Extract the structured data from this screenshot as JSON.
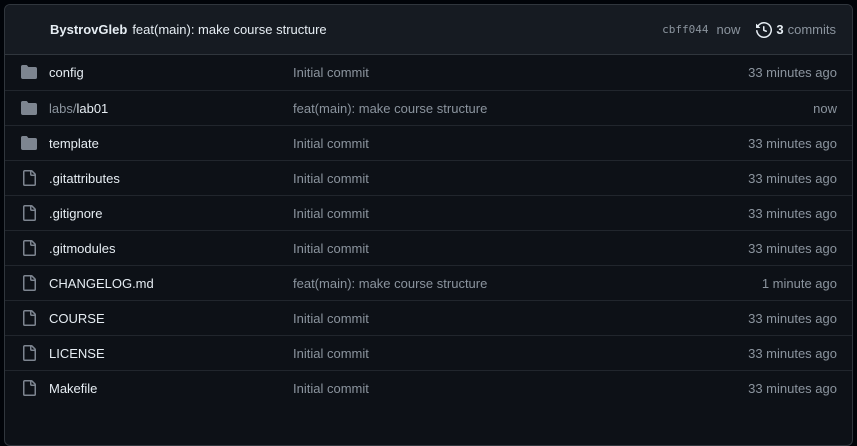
{
  "latest_commit": {
    "author": "BystrovGleb",
    "message": "feat(main): make course structure",
    "sha": "cbff044",
    "when": "now",
    "commit_count": "3",
    "commits_label": "commits"
  },
  "colors": {
    "folder": "#7d8590",
    "file": "#7d8590",
    "text": "#e6edf3",
    "muted": "#8b949e"
  },
  "files": [
    {
      "type": "folder",
      "icon": "folder-icon",
      "prefix": "",
      "name": "config",
      "message": "Initial commit",
      "age": "33 minutes ago"
    },
    {
      "type": "folder",
      "icon": "folder-icon",
      "prefix": "labs/",
      "name": "lab01",
      "message": "feat(main): make course structure",
      "age": "now"
    },
    {
      "type": "folder",
      "icon": "folder-icon",
      "prefix": "",
      "name": "template",
      "message": "Initial commit",
      "age": "33 minutes ago"
    },
    {
      "type": "file",
      "icon": "file-icon",
      "prefix": "",
      "name": ".gitattributes",
      "message": "Initial commit",
      "age": "33 minutes ago"
    },
    {
      "type": "file",
      "icon": "file-icon",
      "prefix": "",
      "name": ".gitignore",
      "message": "Initial commit",
      "age": "33 minutes ago"
    },
    {
      "type": "file",
      "icon": "file-icon",
      "prefix": "",
      "name": ".gitmodules",
      "message": "Initial commit",
      "age": "33 minutes ago"
    },
    {
      "type": "file",
      "icon": "file-icon",
      "prefix": "",
      "name": "CHANGELOG.md",
      "message": "feat(main): make course structure",
      "age": "1 minute ago"
    },
    {
      "type": "file",
      "icon": "file-icon",
      "prefix": "",
      "name": "COURSE",
      "message": "Initial commit",
      "age": "33 minutes ago"
    },
    {
      "type": "file",
      "icon": "file-icon",
      "prefix": "",
      "name": "LICENSE",
      "message": "Initial commit",
      "age": "33 minutes ago"
    },
    {
      "type": "file",
      "icon": "file-icon",
      "prefix": "",
      "name": "Makefile",
      "message": "Initial commit",
      "age": "33 minutes ago"
    }
  ]
}
